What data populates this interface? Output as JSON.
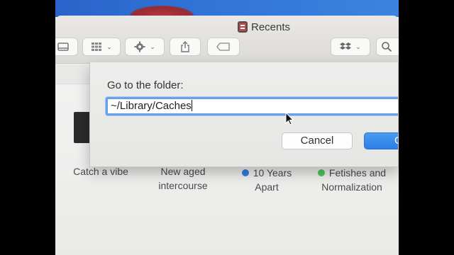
{
  "window": {
    "title": "Recents"
  },
  "toolbar": {
    "chevron": "⌄"
  },
  "dialog": {
    "label": "Go to the folder:",
    "path_value": "~/Library/Caches",
    "cancel_label": "Cancel",
    "go_label_visible": "G"
  },
  "tags": [
    {
      "label_line1": "Catch a vibe",
      "label_line2": "",
      "dot_color": null
    },
    {
      "label_line1": "New aged",
      "label_line2": "intercourse",
      "dot_color": null
    },
    {
      "label_line1": "10 Years",
      "label_line2": "Apart",
      "dot_color": "#2f7de0"
    },
    {
      "label_line1": "Fetishes and",
      "label_line2": "Normalization",
      "dot_color": "#4cc45c"
    }
  ],
  "colors": {
    "accent": "#2a7ee6",
    "focus_ring": "#6aa0ea"
  },
  "icons": [
    "folder-title-icon",
    "view-icon",
    "gallery-icon",
    "gear-icon",
    "share-icon",
    "tag-icon",
    "dropbox-icon",
    "search-icon",
    "pointer-cursor-icon"
  ]
}
